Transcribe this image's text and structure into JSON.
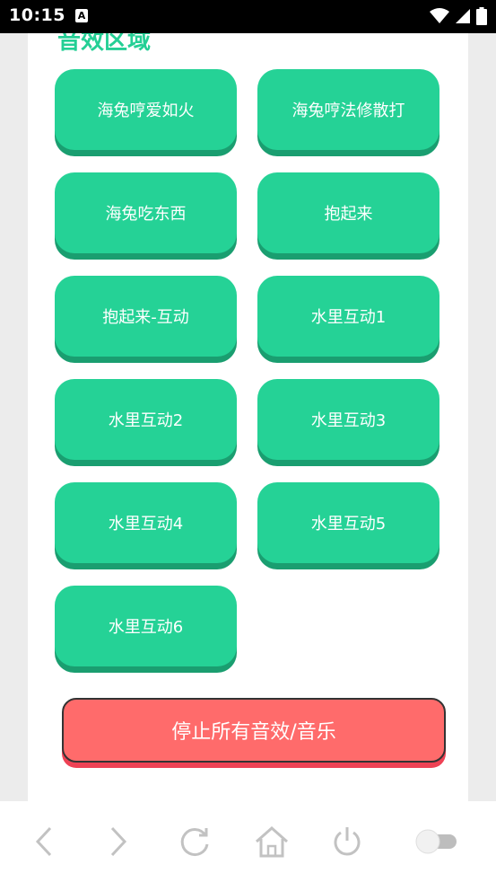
{
  "status_bar": {
    "time": "10:15",
    "notification_glyph": "A"
  },
  "section": {
    "title": "音效区域"
  },
  "sound_buttons": [
    "海兔哼爱如火",
    "海兔哼法修散打",
    "海兔吃东西",
    "抱起来",
    "抱起来-互动",
    "水里互动1",
    "水里互动2",
    "水里互动3",
    "水里互动4",
    "水里互动5",
    "水里互动6"
  ],
  "stop_button": {
    "label": "停止所有音效/音乐"
  },
  "nav": {
    "items": [
      "back-icon",
      "forward-icon",
      "reload-icon",
      "home-icon",
      "power-icon",
      "toggle-switch"
    ]
  },
  "colors": {
    "accent": "#25d296",
    "accent_shadow": "#1a9e70",
    "danger": "#ff6b6b",
    "danger_shadow": "#ee4255"
  }
}
